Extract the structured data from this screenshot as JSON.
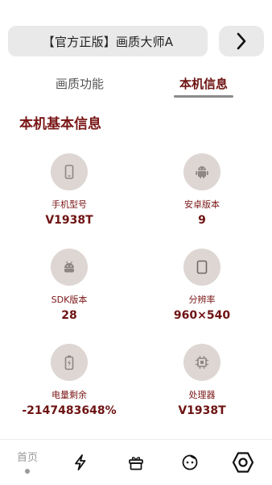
{
  "header": {
    "title": "【官方正版】画质大师A",
    "next_icon": "chevron-right-icon"
  },
  "tabs": [
    {
      "label": "画质功能",
      "active": false
    },
    {
      "label": "本机信息",
      "active": true
    }
  ],
  "section": {
    "title": "本机基本信息"
  },
  "info": [
    {
      "icon": "phone-icon",
      "label": "手机型号",
      "value": "V1938T"
    },
    {
      "icon": "android-icon",
      "label": "安卓版本",
      "value": "9"
    },
    {
      "icon": "android-head-icon",
      "label": "SDK版本",
      "value": "28"
    },
    {
      "icon": "screen-icon",
      "label": "分辨率",
      "value": "960×540"
    },
    {
      "icon": "battery-icon",
      "label": "电量剩余",
      "value": "-2147483648%"
    },
    {
      "icon": "cpu-icon",
      "label": "处理器",
      "value": "V1938T"
    }
  ],
  "bottom_nav": [
    {
      "label": "首页",
      "icon": "home-icon",
      "active": true
    },
    {
      "label": "",
      "icon": "lightning-icon"
    },
    {
      "label": "",
      "icon": "gift-icon"
    },
    {
      "label": "",
      "icon": "face-icon"
    },
    {
      "label": "",
      "icon": "settings-hexagon-icon"
    }
  ],
  "colors": {
    "accent": "#7a1616",
    "circle_bg": "#ddd6d2",
    "pill_bg": "#e9e9e9"
  }
}
